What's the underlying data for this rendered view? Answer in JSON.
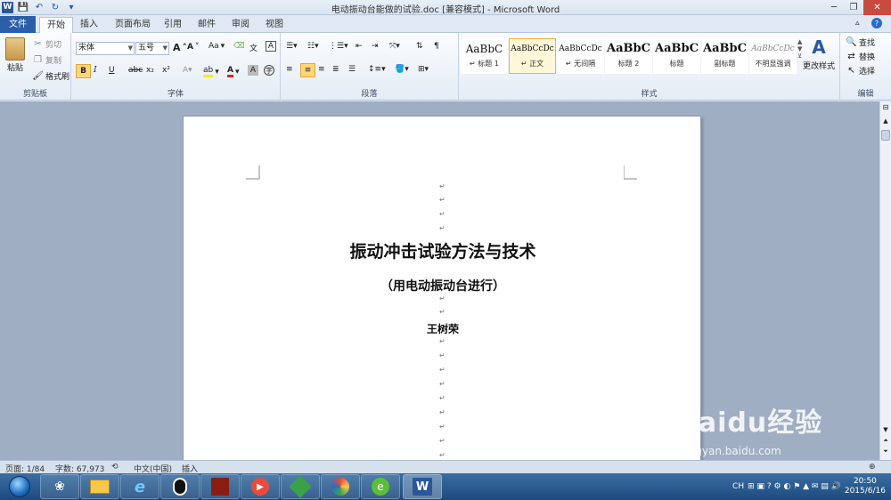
{
  "window": {
    "title": "电动振动台能做的试验.doc [兼容模式] - Microsoft Word",
    "app_icon": "W"
  },
  "tabs": [
    "文件",
    "开始",
    "插入",
    "页面布局",
    "引用",
    "邮件",
    "审阅",
    "视图"
  ],
  "clipboard": {
    "paste": "粘贴",
    "cut": "剪切",
    "copy": "复制",
    "format_painter": "格式刷",
    "group": "剪贴板"
  },
  "font": {
    "name": "宋体",
    "size": "五号",
    "group": "字体",
    "bold": "B",
    "italic": "I",
    "underline": "U",
    "strike": "abc",
    "sub": "x₂",
    "sup": "x²",
    "grow": "A",
    "shrink": "A",
    "case": "Aa"
  },
  "paragraph": {
    "group": "段落"
  },
  "styles": {
    "group": "样式",
    "items": [
      {
        "sample": "AaBbC",
        "name": "↵ 标题 1"
      },
      {
        "sample": "AaBbCcDc",
        "name": "↵ 正文"
      },
      {
        "sample": "AaBbCcDc",
        "name": "↵ 无间隔"
      },
      {
        "sample": "AaBbC",
        "name": "标题 2"
      },
      {
        "sample": "AaBbC",
        "name": "标题"
      },
      {
        "sample": "AaBbC",
        "name": "副标题"
      },
      {
        "sample": "AaBbCcDc",
        "name": "不明显强调"
      }
    ],
    "change_styles": "更改样式"
  },
  "editing": {
    "group": "编辑",
    "find": "查找",
    "replace": "替换",
    "select": "选择"
  },
  "document": {
    "title": "振动冲击试验方法与技术",
    "subtitle": "（用电动振动台进行）",
    "author": "王树荣",
    "para_mark": "↵"
  },
  "statusbar": {
    "page": "页面: 1/84",
    "words": "字数: 67,973",
    "language": "中文(中国)",
    "mode": "插入"
  },
  "taskbar": {
    "time": "20:50",
    "date": "2015/6/16",
    "ime": "CH"
  },
  "watermark": {
    "brand": "Baidu经验",
    "url": "jingyan.baidu.com"
  }
}
